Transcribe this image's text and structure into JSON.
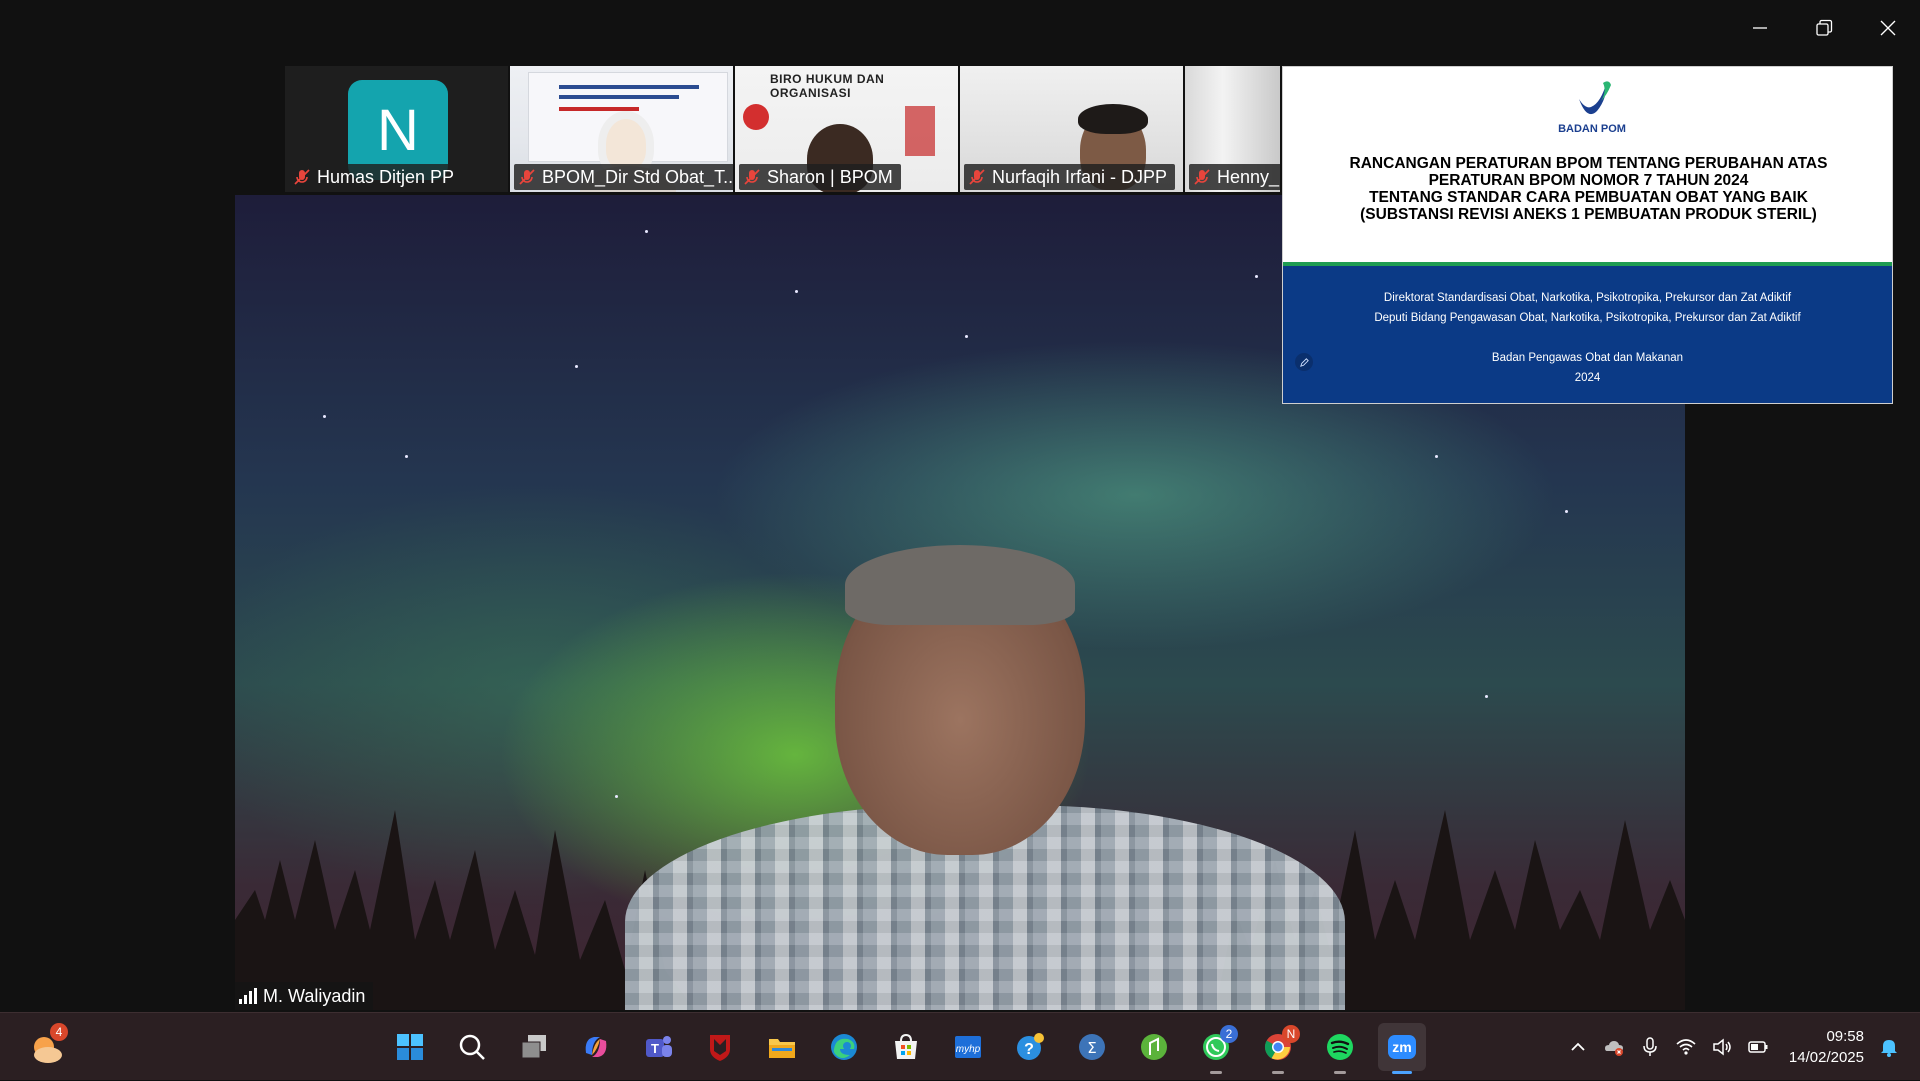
{
  "window": {
    "controls": [
      "minimize",
      "restore",
      "close"
    ]
  },
  "participants": [
    {
      "name": "Humas Ditjen PP",
      "avatar_letter": "N",
      "muted": true
    },
    {
      "name": "BPOM_Dir Std Obat_T...",
      "muted": true
    },
    {
      "name": "Sharon | BPOM",
      "muted": true,
      "background_text": "BIRO HUKUM DAN ORGANISASI"
    },
    {
      "name": "Nurfaqih Irfani - DJPP",
      "muted": true
    },
    {
      "name": "Henny_",
      "muted": true
    }
  ],
  "main_speaker": {
    "name": "M. Waliyadin"
  },
  "slide": {
    "logo_text": "BADAN POM",
    "title_lines": [
      "RANCANGAN PERATURAN BPOM TENTANG PERUBAHAN ATAS",
      "PERATURAN BPOM NOMOR 7 TAHUN 2024",
      "TENTANG STANDAR CARA PEMBUATAN OBAT YANG BAIK",
      "(SUBSTANSI REVISI ANEKS 1 PEMBUATAN PRODUK STERIL)"
    ],
    "org_line1": "Direktorat Standardisasi Obat, Narkotika, Psikotropika, Prekursor dan Zat Adiktif",
    "org_line2": "Deputi Bidang Pengawasan Obat, Narkotika, Psikotropika, Prekursor dan Zat Adiktif",
    "agency": "Badan Pengawas Obat dan Makanan",
    "year": "2024",
    "colors": {
      "header_bg": "#ffffff",
      "divider": "#1f9c52",
      "footer_bg": "#0b3a86"
    }
  },
  "taskbar": {
    "weather_badge": "4",
    "apps": [
      {
        "name": "start-icon"
      },
      {
        "name": "search-icon"
      },
      {
        "name": "task-view-icon"
      },
      {
        "name": "copilot-icon"
      },
      {
        "name": "teams-icon"
      },
      {
        "name": "mcafee-icon"
      },
      {
        "name": "file-explorer-icon"
      },
      {
        "name": "edge-icon"
      },
      {
        "name": "store-icon"
      },
      {
        "name": "myhp-icon"
      },
      {
        "name": "help-icon"
      },
      {
        "name": "calculator-icon"
      },
      {
        "name": "sheets-icon"
      },
      {
        "name": "whatsapp-icon",
        "badge": "2"
      },
      {
        "name": "chrome-icon",
        "badge": "N"
      },
      {
        "name": "spotify-icon"
      },
      {
        "name": "zoom-icon",
        "label": "zm",
        "active": true
      }
    ],
    "tray": [
      "chevron-up-icon",
      "onedrive-icon",
      "microphone-icon",
      "wifi-icon",
      "volume-icon",
      "battery-icon"
    ],
    "time": "09:58",
    "date": "14/02/2025"
  }
}
